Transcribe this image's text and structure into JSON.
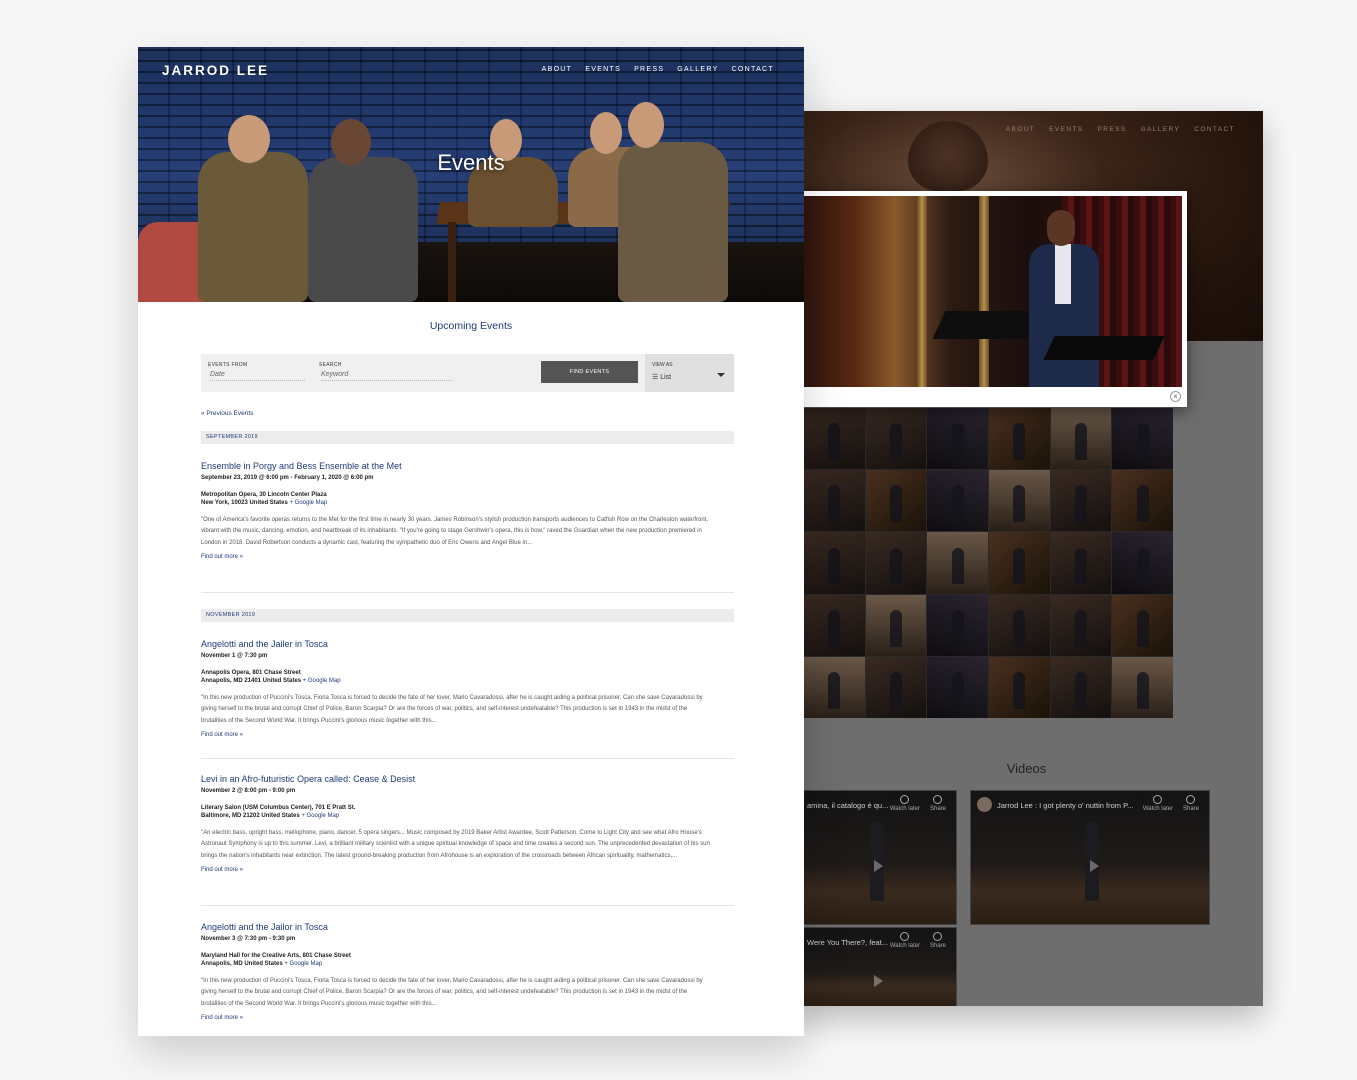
{
  "back_window": {
    "nav": [
      "ABOUT",
      "EVENTS",
      "PRESS",
      "GALLERY",
      "CONTACT"
    ],
    "videos_title": "Videos",
    "videos": [
      {
        "title": "amina, il catalogo è qu...",
        "watch_later": "Watch later",
        "share": "Share"
      },
      {
        "title": "Jarrod Lee : I got plenty o' nuttin from P...",
        "watch_later": "Watch later",
        "share": "Share"
      },
      {
        "title": "Were You There?, feat...",
        "watch_later": "Watch later",
        "share": "Share"
      }
    ]
  },
  "lightbox": {
    "close_glyph": "×"
  },
  "front_window": {
    "logo": "JARROD LEE",
    "nav": [
      "ABOUT",
      "EVENTS",
      "PRESS",
      "GALLERY",
      "CONTACT"
    ],
    "hero_title": "Events",
    "upcoming_title": "Upcoming Events",
    "filter": {
      "events_from_label": "EVENTS FROM",
      "events_from_placeholder": "Date",
      "search_label": "SEARCH",
      "search_placeholder": "Keyword",
      "find_button": "FIND EVENTS",
      "view_as_label": "VIEW AS",
      "view_as_value": "List"
    },
    "previous_events": "« Previous Events",
    "months": [
      "SEPTEMBER 2019",
      "NOVEMBER 2019"
    ],
    "events": [
      {
        "title": "Ensemble in Porgy and Bess Ensemble at the Met",
        "date": "September 23, 2019 @ 6:00 pm - February 1, 2020 @ 6:00 pm",
        "venue": "Metropolitan Opera, 30 Lincoln Center Plaza",
        "city": "New York, 10023 United States",
        "map": "+ Google Map",
        "description": "\"One of America's favorite operas returns to the Met for the first time in nearly 30 years. James Robinson's stylish production transports audiences to Catfish Row on the Charleston waterfront, vibrant with the music, dancing, emotion, and heartbreak of its inhabitants. \"If you're going to stage Gershwin's opera, this is how,\" raved the Guardian when the new production premiered in London in 2018. David Robertson conducts a dynamic cast, featuring the sympathetic duo of Eric Owens and Angel Blue in...",
        "more": "Find out more »"
      },
      {
        "title": "Angelotti and the Jailer in Tosca",
        "date": "November 1 @ 7:30 pm",
        "venue": "Annapolis Opera, 801 Chase Street",
        "city": "Annapolis, MD 21401 United States",
        "map": "+ Google Map",
        "description": "\"In this new production of Puccini's Tosca, Fioria Tosca is forced to decide the fate of her lover, Mario Cavaradossi, after he is caught aiding a political prisoner. Can she save Cavaradossi by giving herself to the brutal and corrupt Chief of Police, Baron Scarpia? Or are the forces of war, politics, and self-interest undefeatable? This production is set in 1943 in the midst of the brutalities of the Second World War. It brings Puccini's glorious music together with this...",
        "more": "Find out more »"
      },
      {
        "title": "Levi in an Afro-futuristic Opera called: Cease & Desist",
        "date": "November 2 @ 8:00 pm - 9:00 pm",
        "venue": "Literary Salon (USM Columbus Center), 701 E Pratt St.",
        "city": "Baltimore, MD 21202 United States",
        "map": "+ Google Map",
        "description": "\"An electric bass, upright bass, mellophone, piano, dancer, 5 opera singers... Music composed by 2019 Baker Artist Awardee, Scott Patterson. Come to Light City and see what Afro House's Astronaut Symphony is up to this summer. Levi, a brilliant military scientist with a unique spiritual knowledge of space and time creates a second sun. The unprecedented devastation of his sun brings the nation's inhabitants near extinction. The latest ground-breaking production from Afrohouse is an exploration of the crossroads between African spirituality, mathematics,...",
        "more": "Find out more »"
      },
      {
        "title": "Angelotti and the Jailor in Tosca",
        "date": "November 3 @ 7:30 pm - 9:30 pm",
        "venue": "Maryland Hall for the Creative Arts, 801 Chase Street",
        "city": "Annapolis, MD United States",
        "map": "+ Google Map",
        "description": "\"In this new production of Puccini's Tosca, Fioria Tosca is forced to decide the fate of her lover, Mario Cavaradossi, after he is caught aiding a political prisoner. Can she save Cavaradossi by giving herself to the brutal and corrupt Chief of Police, Baron Scarpia? Or are the forces of war, politics, and self-interest undefeatable? This production is set in 1943 in the midst of the brutalities of the Second World War. It brings Puccini's glorious music together with this...",
        "more": "Find out more »"
      }
    ]
  },
  "colors": {
    "accent": "#1e3a78",
    "button": "#555555",
    "month_bar": "#ececec"
  }
}
